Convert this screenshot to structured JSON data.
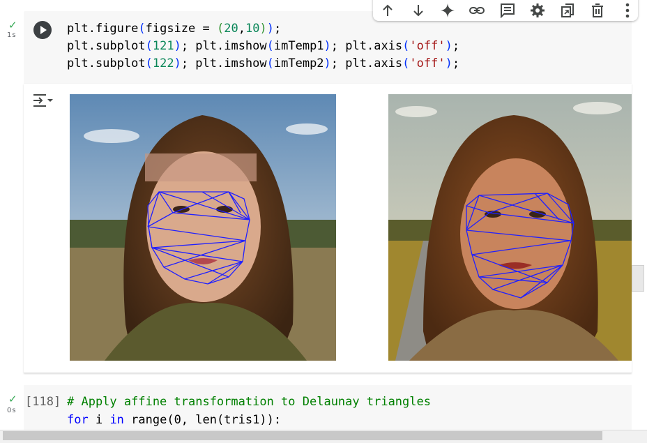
{
  "cell1": {
    "status_check": "✓",
    "duration": "1s",
    "code_lines": [
      "plt.figure(figsize = (20,10));",
      "plt.subplot(121); plt.imshow(imTemp1); plt.axis('off');",
      "plt.subplot(122); plt.imshow(imTemp2); plt.axis('off');"
    ]
  },
  "cell2": {
    "status_check": "✓",
    "duration": "0s",
    "exec_count": "[118]",
    "comment": "# Apply affine transformation to Delaunay triangles",
    "line2_kw_for": "for",
    "line2_var": " i ",
    "line2_kw_in": "in",
    "line2_rest": " range(0, len(tris1)):"
  },
  "toolbar": {
    "icons": [
      "arrow-up-icon",
      "arrow-down-icon",
      "sparkle-icon",
      "link-icon",
      "comment-icon",
      "gear-icon",
      "open-in-tab-icon",
      "trash-icon",
      "more-vert-icon"
    ]
  },
  "output": {
    "images": [
      {
        "name": "imTemp1",
        "description_visible": false
      },
      {
        "name": "imTemp2",
        "description_visible": false
      }
    ],
    "mesh_color": "#2020ff"
  },
  "colors": {
    "cell_bg": "#f7f7f7",
    "success": "#34a853",
    "keyword": "#0000ff",
    "string": "#a31515",
    "number": "#098658",
    "comment": "#008000"
  }
}
